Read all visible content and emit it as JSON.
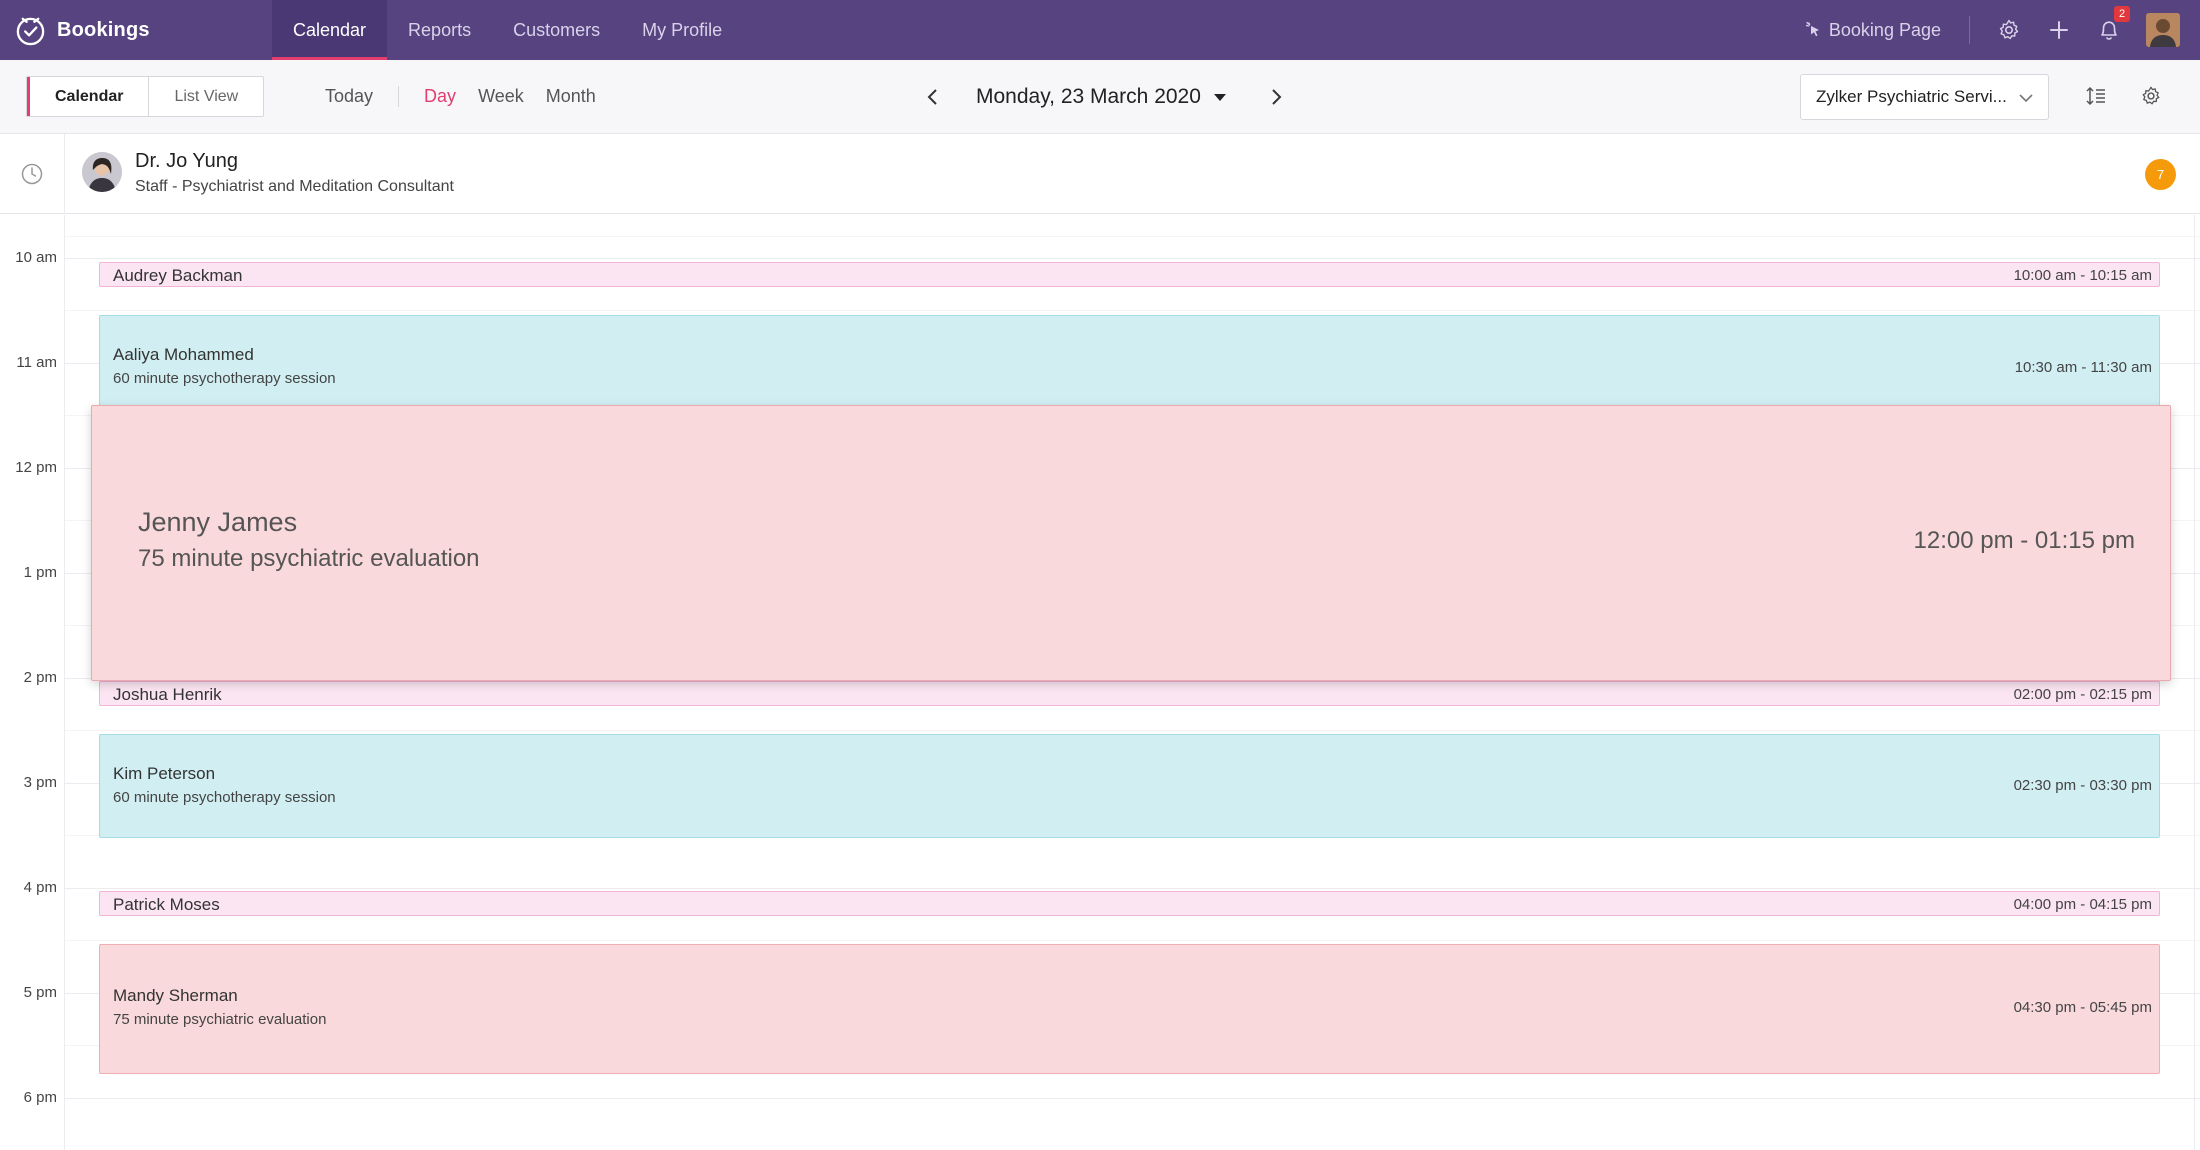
{
  "app": {
    "name": "Bookings"
  },
  "nav": [
    {
      "label": "Calendar",
      "active": true
    },
    {
      "label": "Reports",
      "active": false
    },
    {
      "label": "Customers",
      "active": false
    },
    {
      "label": "My Profile",
      "active": false
    }
  ],
  "topbar": {
    "booking_page_label": "Booking Page",
    "notification_count": "2",
    "icons": [
      "settings-icon",
      "plus-icon",
      "bell-icon"
    ]
  },
  "toolbar": {
    "view_toggle": [
      {
        "label": "Calendar",
        "active": true
      },
      {
        "label": "List View",
        "active": false
      }
    ],
    "today_label": "Today",
    "ranges": [
      {
        "label": "Day",
        "active": true
      },
      {
        "label": "Week",
        "active": false
      },
      {
        "label": "Month",
        "active": false
      }
    ],
    "current_date": "Monday, 23 March 2020",
    "service_select": "Zylker Psychiatric Servi..."
  },
  "staff": {
    "name": "Dr. Jo Yung",
    "role": "Staff - Psychiatrist and Meditation Consultant",
    "appointment_count": "7"
  },
  "time_labels": [
    "10 am",
    "11 am",
    "12 pm",
    "1 pm",
    "2 pm",
    "3 pm",
    "4 pm",
    "5 pm",
    "6 pm"
  ],
  "events": [
    {
      "name": "Audrey Backman",
      "service": "",
      "time": "10:00 am - 10:15 am"
    },
    {
      "name": "Aaliya Mohammed",
      "service": "60 minute psychotherapy session",
      "time": "10:30 am - 11:30 am"
    },
    {
      "name": "Jenny James",
      "service": "75 minute psychiatric evaluation",
      "time": "12:00 pm - 01:15 pm"
    },
    {
      "name": "Joshua Henrik",
      "service": "",
      "time": "02:00 pm - 02:15 pm"
    },
    {
      "name": "Kim Peterson",
      "service": "60 minute psychotherapy session",
      "time": "02:30 pm - 03:30 pm"
    },
    {
      "name": "Patrick Moses",
      "service": "",
      "time": "04:00 pm - 04:15 pm"
    },
    {
      "name": "Mandy Sherman",
      "service": "75 minute psychiatric evaluation",
      "time": "04:30 pm - 05:45 pm"
    }
  ],
  "colors": {
    "topbar": "#56437f",
    "accent": "#e23e70",
    "event_pink": "#fbe5f2",
    "event_cyan": "#d1eff3",
    "event_rose": "#f9d9dc",
    "count_badge": "#f59a0b"
  }
}
